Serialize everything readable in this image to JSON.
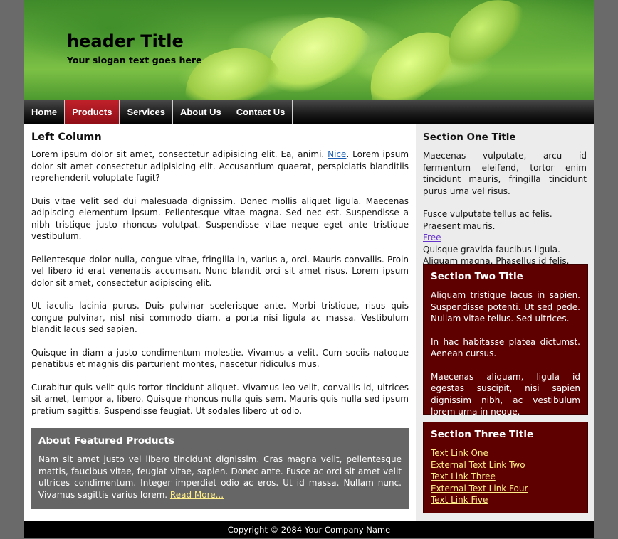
{
  "header": {
    "title": "header Title",
    "slogan": "Your slogan text goes here"
  },
  "nav": [
    {
      "label": "Home",
      "active": false
    },
    {
      "label": "Products",
      "active": true
    },
    {
      "label": "Services",
      "active": false
    },
    {
      "label": "About Us",
      "active": false
    },
    {
      "label": "Contact Us",
      "active": false
    }
  ],
  "left_column": {
    "title": "Left Column",
    "p1_before": "Lorem ipsum dolor sit amet, consectetur adipisicing elit. Ea, animi. ",
    "p1_link": "Nice",
    "p1_after": ". Lorem ipsum dolor sit amet consectetur adipisicing elit. Accusantium quaerat, perspiciatis blanditiis reprehenderit voluptate fugit?",
    "p2": "Duis vitae velit sed dui malesuada dignissim. Donec mollis aliquet ligula. Maecenas adipiscing elementum ipsum. Pellentesque vitae magna. Sed nec est. Suspendisse a nibh tristique justo rhoncus volutpat. Suspendisse vitae neque eget ante tristique vestibulum.",
    "p3": "Pellentesque dolor nulla, congue vitae, fringilla in, varius a, orci. Mauris convallis. Proin vel libero id erat venenatis accumsan. Nunc blandit orci sit amet risus. Lorem ipsum dolor sit amet, consectetur adipiscing elit.",
    "p4": "Ut iaculis lacinia purus. Duis pulvinar scelerisque ante. Morbi tristique, risus quis congue pulvinar, nisl nisi commodo diam, a porta nisi ligula ac massa. Vestibulum blandit lacus sed sapien.",
    "p5": "Quisque in diam a justo condimentum molestie. Vivamus a velit. Cum sociis natoque penatibus et magnis dis parturient montes, nascetur ridiculus mus.",
    "p6": "Curabitur quis velit quis tortor tincidunt aliquet. Vivamus leo velit, convallis id, ultrices sit amet, tempor a, libero. Quisque rhoncus nulla quis sem. Mauris quis nulla sed ipsum pretium sagittis. Suspendisse feugiat. Ut sodales libero ut odio."
  },
  "featured": {
    "title": "About Featured Products",
    "text": "Nam sit amet justo vel libero tincidunt dignissim. Cras magna velit, pellentesque mattis, faucibus vitae, feugiat vitae, sapien. Donec ante. Fusce ac orci sit amet velit ultrices condimentum. Integer imperdiet odio ac eros. Ut id massa. Nullam nunc. Vivamus sagittis varius lorem. ",
    "link": "Read More..."
  },
  "section_one": {
    "title": "Section One Title",
    "p1": "Maecenas vulputate, arcu id fermentum eleifend, tortor enim tincidunt mauris, fringilla tincidunt purus urna vel risus.",
    "line1": "Fusce vulputate tellus ac felis.",
    "line2": "Praesent mauris.",
    "link": "Free",
    "line3": "Quisque gravida faucibus ligula.",
    "line4": "Aliquam magna. Phasellus id felis."
  },
  "section_two": {
    "title": "Section Two Title",
    "p1": "Aliquam tristique lacus in sapien. Suspendisse potenti. Ut sed pede. Nullam vitae tellus. Sed ultrices.",
    "p2": "In hac habitasse platea dictumst. Aenean cursus.",
    "p3": "Maecenas aliquam, ligula id egestas suscipit, nisi sapien dignissim nibh, ac vestibulum lorem urna in neque."
  },
  "section_three": {
    "title": "Section Three Title",
    "links": [
      "Text Link One",
      "External Text Link Two",
      "Text Link Three",
      "External Text Link Four",
      "Text Link Five"
    ]
  },
  "footer": {
    "text": "Copyright © 2084 Your Company Name"
  },
  "colors": {
    "nav_active": "#a3141d",
    "dark_box": "#5e0000",
    "featured_bg": "#666666",
    "page_bg": "#6a6a6a"
  }
}
